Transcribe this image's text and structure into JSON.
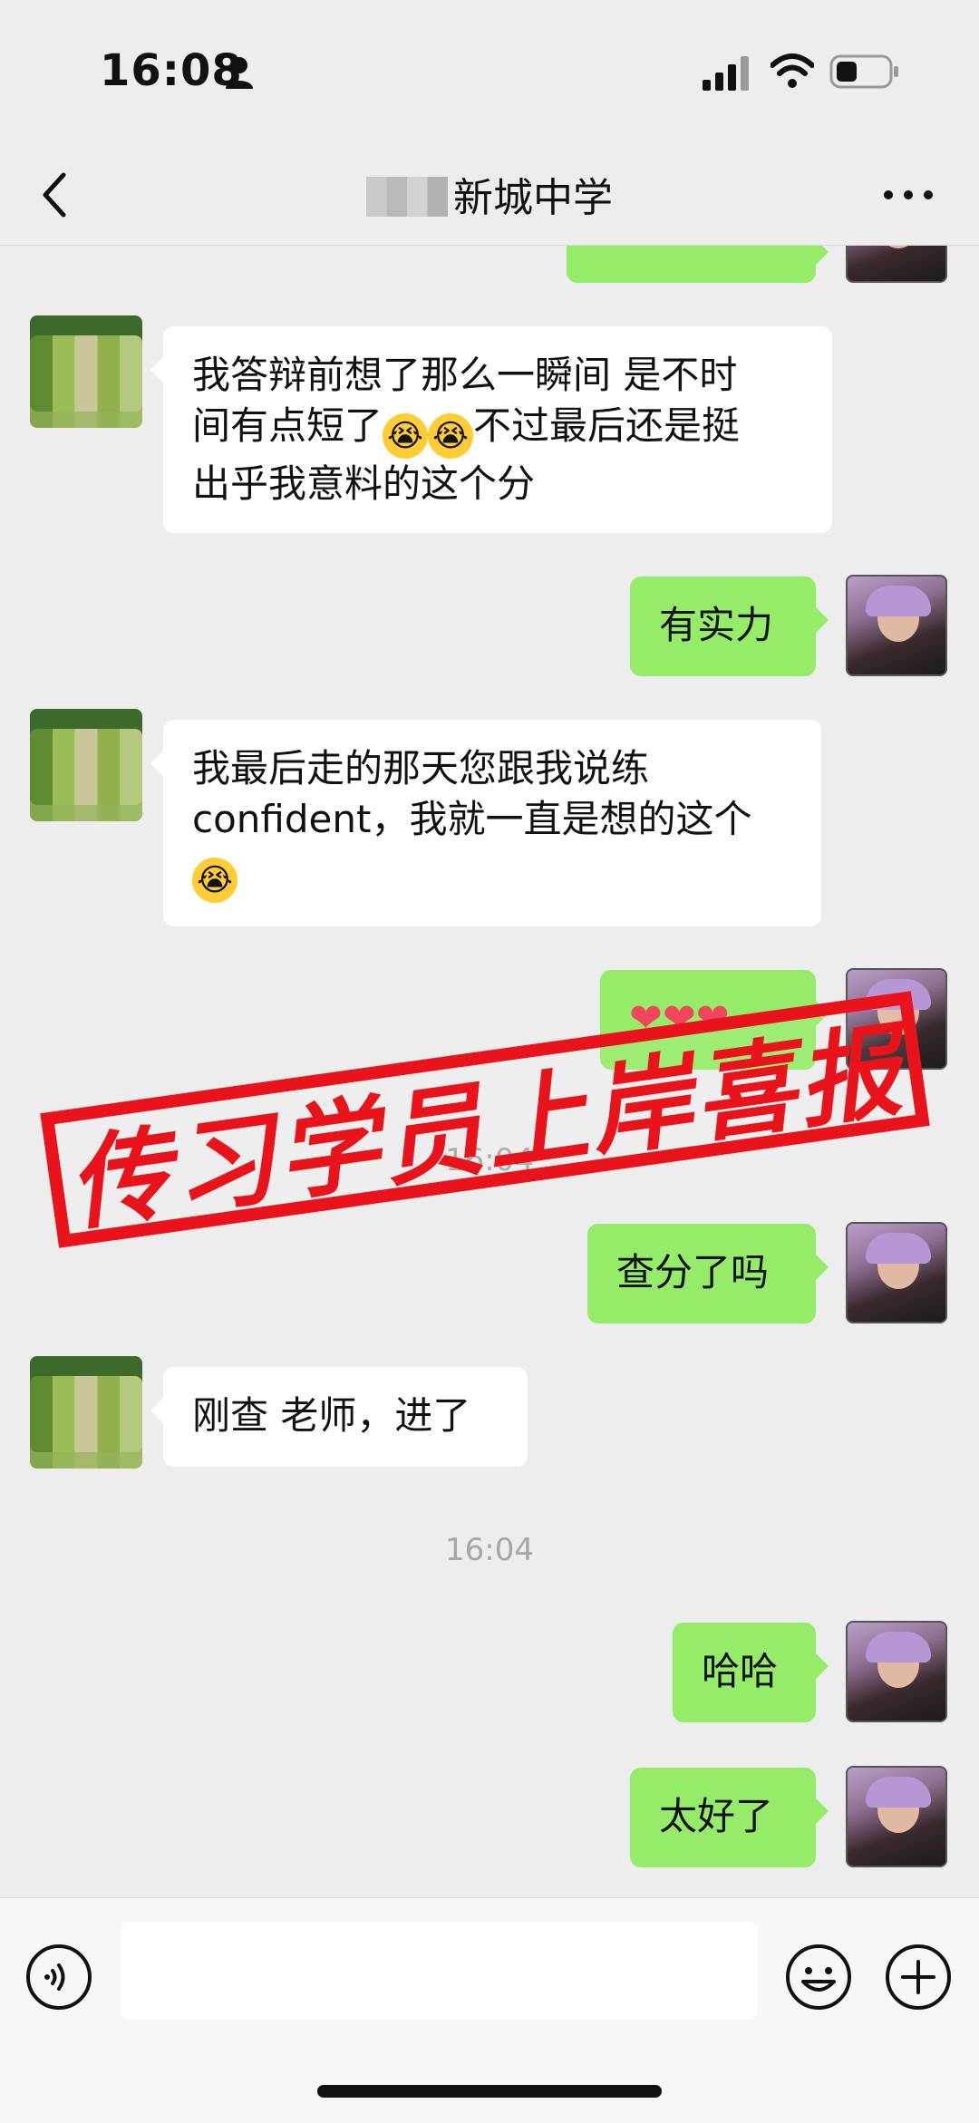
{
  "status_bar": {
    "time": "16:08",
    "icons": [
      "person-icon",
      "signal-icon",
      "wifi-icon",
      "battery-icon"
    ]
  },
  "header": {
    "back_icon": "chevron-left-icon",
    "title": "新城中学",
    "more_icon": "more-dots-icon"
  },
  "messages": [
    {
      "from": "other",
      "text_1": "我答辩前想了那么一瞬间 是不时",
      "text_2": "间有点短了",
      "text_3": "不过最后还是挺",
      "text_4": "出乎我意料的这个分",
      "emoji": "😭"
    },
    {
      "from": "me",
      "text": "有实力"
    },
    {
      "from": "other",
      "text_1": "我最后走的那天您跟我说练",
      "text_2": "confident，我就一直是想的这个",
      "emoji": "😭"
    },
    {
      "from": "me",
      "text": "❤❤❤"
    },
    {
      "from": "me",
      "text": "查分了吗"
    },
    {
      "from": "other",
      "text": "刚查 老师，进了"
    },
    {
      "from": "me",
      "text": "哈哈"
    },
    {
      "from": "me",
      "text": "太好了"
    }
  ],
  "timestamps": [
    "16:04",
    "16:04"
  ],
  "stamp": {
    "text": "传习学员上岸喜报",
    "color": "#e8131b"
  },
  "input_bar": {
    "voice_icon": "voice-icon",
    "placeholder": "",
    "emoji_icon": "smile-icon",
    "plus_icon": "plus-icon"
  },
  "colors": {
    "background": "#ededed",
    "my_bubble": "#95ec69",
    "their_bubble": "#ffffff"
  }
}
